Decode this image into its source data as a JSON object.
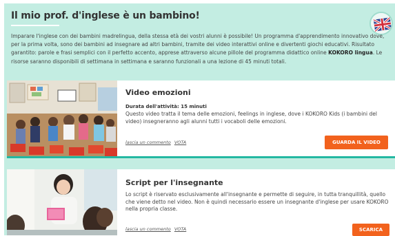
{
  "header": {
    "title": "Il mio prof. d'inglese è un bambino!",
    "intro_before_bold": "Imparare l'inglese con dei bambini madrelingua, della stessa età dei vostri alunni è possibile! Un programma d'apprendimento innovativo dove, per la prima volta, sono dei bambini ad insegnare ad altri bambini, tramite dei video interattivi online e divertenti giochi educativi. Risultato garantito: parole e frasi semplici con il perfetto accento, apprese attraverso alcune pillole del programma didattico online ",
    "intro_bold": "KOKORO lingua",
    "intro_after_bold": ". Le risorse saranno disponibili di settimana in settimana e saranno funzionali a una lezione di 45 minuti totali.",
    "flag_icon": "uk-flag-icon"
  },
  "cards": [
    {
      "title": "Video emozioni",
      "meta": "Durata dell'attività: 15 minuti",
      "description": "Questo video tratta il tema delle emozioni, feelings in inglese, dove i KOKORO Kids (i bambini del video) insegneranno agli alunni tutti i vocaboli delle emozioni.",
      "comment_link": "lascia un commento",
      "vote_link": "VOTA",
      "button_label": "GUARDA IL VIDEO",
      "thumbnail": "classroom-children-photo"
    },
    {
      "title": "Script per l'insegnante",
      "meta": "",
      "description": "Lo script è riservato esclusivamente all'insegnante e permette di seguire, in tutta tranquillità, quello che viene detto nel video. Non è quindi necessario essere un insegnante d'inglese per usare KOKORO nella propria classe.",
      "comment_link": "lascia un commento",
      "vote_link": "VOTA",
      "button_label": "SCARICA",
      "thumbnail": "teacher-with-students-photo"
    }
  ],
  "colors": {
    "panel_bg": "#c3ede2",
    "accent_button": "#f2621d",
    "card_divider": "#23b8a2"
  }
}
